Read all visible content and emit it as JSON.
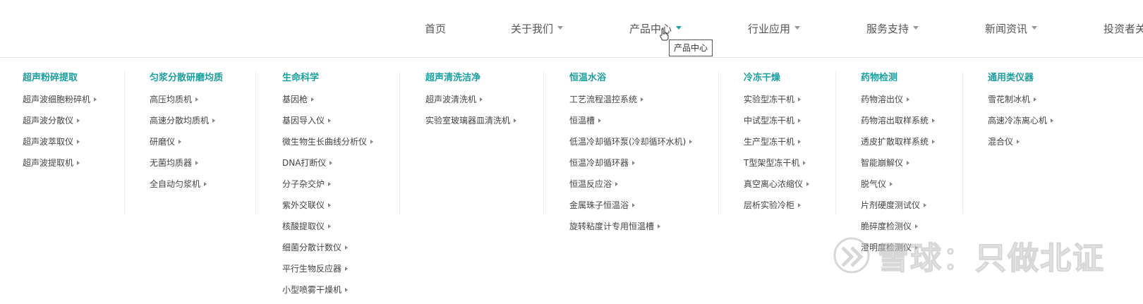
{
  "nav": {
    "items": [
      {
        "label": "首页",
        "has_caret": false
      },
      {
        "label": "关于我们",
        "has_caret": true
      },
      {
        "label": "产品中心",
        "has_caret": true,
        "active": true
      },
      {
        "label": "行业应用",
        "has_caret": true
      },
      {
        "label": "服务支持",
        "has_caret": true
      },
      {
        "label": "新闻资讯",
        "has_caret": true
      },
      {
        "label": "投资者关",
        "has_caret": false
      }
    ],
    "tooltip": "产品中心"
  },
  "mega": {
    "columns": [
      {
        "title": "超声粉碎提取",
        "items": [
          "超声波细胞粉碎机",
          "超声波分散仪",
          "超声波萃取仪",
          "超声波提取机"
        ]
      },
      {
        "title": "匀浆分散研磨均质",
        "items": [
          "高压均质机",
          "高速分散均质机",
          "研磨仪",
          "无菌均质器",
          "全自动匀浆机"
        ]
      },
      {
        "title": "生命科学",
        "items": [
          "基因枪",
          "基因导入仪",
          "微生物生长曲线分析仪",
          "DNA打断仪",
          "分子杂交炉",
          "紫外交联仪",
          "核酸提取仪",
          "细菌分散计数仪",
          "平行生物反应器",
          "小型喷雾干燥机"
        ]
      },
      {
        "title": "超声清洗洁净",
        "items": [
          "超声波清洗机",
          "实验室玻璃器皿清洗机"
        ]
      },
      {
        "title": "恒温水浴",
        "items": [
          "工艺流程温控系统",
          "恒温槽",
          "低温冷却循环泵(冷却循环水机)",
          "恒温冷却循环器",
          "恒温反应浴",
          "金属珠子恒温浴",
          "旋转粘度计专用恒温槽"
        ]
      },
      {
        "title": "冷冻干燥",
        "items": [
          "实验型冻干机",
          "中试型冻干机",
          "生产型冻干机",
          "T型架型冻干机",
          "真空离心浓缩仪",
          "层析实验冷柜"
        ]
      },
      {
        "title": "药物检测",
        "items": [
          "药物溶出仪",
          "药物溶出取样系统",
          "透皮扩散取样系统",
          "智能崩解仪",
          "脱气仪",
          "片剂硬度测试仪",
          "脆碎度检测仪",
          "澄明度检测仪"
        ]
      },
      {
        "title": "通用类仪器",
        "items": [
          "雪花制冰机",
          "高速冷冻离心机",
          "混合仪"
        ]
      }
    ]
  },
  "watermark": {
    "text": "雪球：只做北证"
  },
  "colors": {
    "accent": "#1a9e9e",
    "text": "#444444",
    "nav_text": "#555555",
    "divider": "#ececec"
  }
}
